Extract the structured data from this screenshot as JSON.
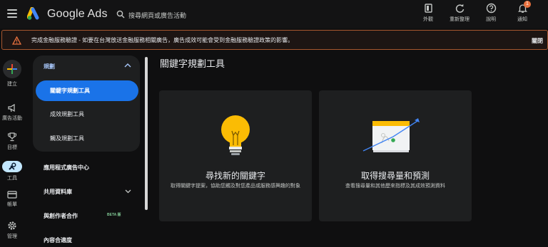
{
  "header": {
    "brand": "Google Ads",
    "search_placeholder": "搜尋網頁或廣告活動",
    "actions": [
      {
        "icon": "appearance-icon",
        "label": "外觀"
      },
      {
        "icon": "refresh-icon",
        "label": "重新整理"
      },
      {
        "icon": "help-icon",
        "label": "說明"
      },
      {
        "icon": "bell-icon",
        "label": "通知",
        "badge": "1"
      }
    ]
  },
  "banner": {
    "message": "完成金融服務驗證 - 如要在台灣放送金融服務相關廣告，廣告成效可能會受到金融服務驗證政策的影響。",
    "close_label": "關閉"
  },
  "rail": {
    "items": [
      {
        "icon": "plus-icon",
        "label": "建立"
      },
      {
        "icon": "megaphone-icon",
        "label": "廣告活動"
      },
      {
        "icon": "trophy-icon",
        "label": "目標"
      },
      {
        "icon": "tools-icon",
        "label": "工具"
      },
      {
        "icon": "billing-icon",
        "label": "帳單"
      },
      {
        "icon": "settings-icon",
        "label": "管理"
      }
    ]
  },
  "nav": {
    "section": "規劃",
    "sub_items": [
      {
        "label": "關鍵字規劃工具",
        "active": true
      },
      {
        "label": "成效規劃工具",
        "active": false
      },
      {
        "label": "觸及規劃工具",
        "active": false
      }
    ],
    "items": [
      {
        "label": "應用程式廣告中心"
      },
      {
        "label": "共用資料庫"
      },
      {
        "label": "與創作者合作",
        "badge": "BETA 版"
      },
      {
        "label": "內容合適度"
      }
    ]
  },
  "main": {
    "title": "關鍵字規劃工具",
    "cards": [
      {
        "title": "尋找新的關鍵字",
        "desc": "取得關鍵字提案，協助您觸及對您產品或服務感興趣的對象"
      },
      {
        "title": "取得搜尋量和預測",
        "desc": "查看搜尋量和其他歷來指標及其成效預測資料"
      }
    ]
  },
  "colors": {
    "accent": "#1a73e8",
    "warning": "#e8713e",
    "bulb": "#fbbc04"
  }
}
